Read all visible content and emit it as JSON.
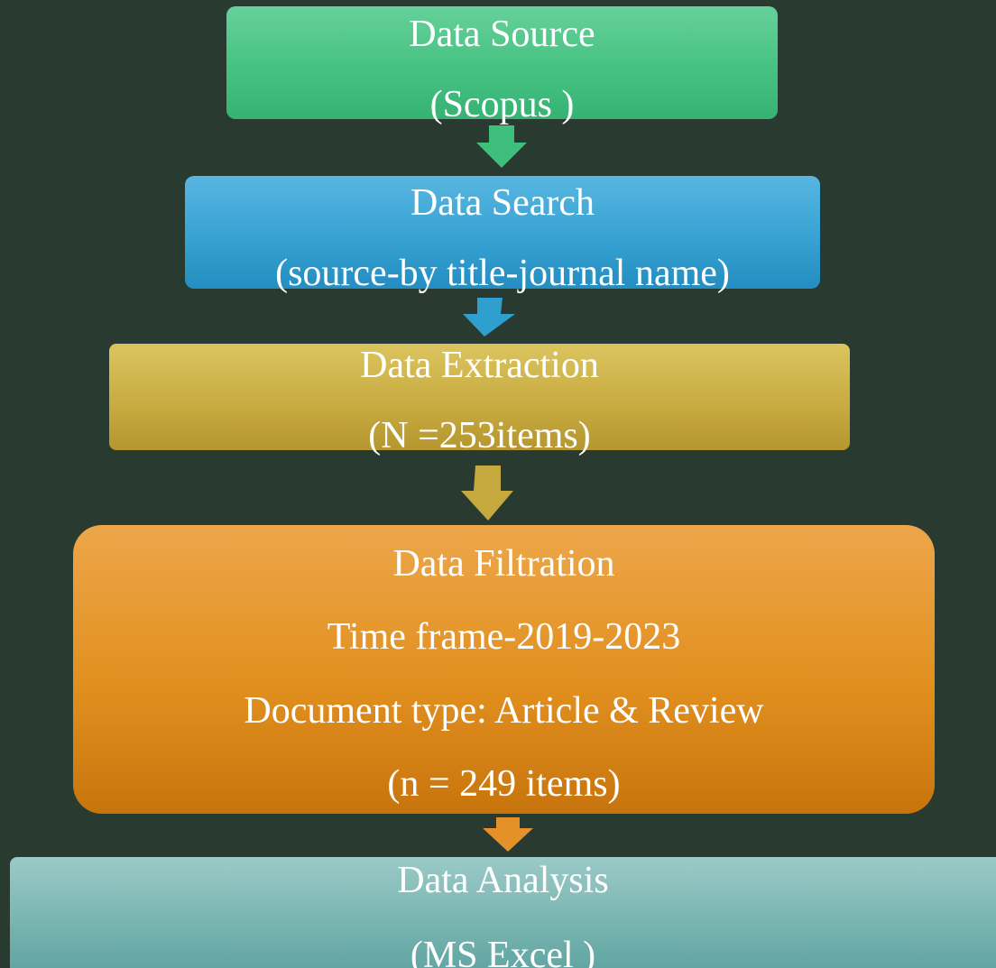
{
  "steps": [
    {
      "title": "Data Source",
      "detail": "(Scopus )"
    },
    {
      "title": "Data Search",
      "detail": "(source-by title-journal name)"
    },
    {
      "title": "Data Extraction",
      "detail": "(N =253items)"
    },
    {
      "title": "Data Filtration",
      "lines": [
        "Time frame-2019-2023",
        "Document type: Article & Review",
        "(n = 249 items)"
      ]
    },
    {
      "title": "Data Analysis",
      "detail": "(MS Excel )"
    }
  ],
  "colors": {
    "background": "#293a31",
    "source": "#46c281",
    "search": "#37a2d3",
    "extraction": "#c9ac42",
    "filtration": "#e1901f",
    "analysis": "#7bb6b2",
    "text": "#ffffff"
  },
  "connectors": [
    "arrow-down-icon",
    "arrow-down-icon",
    "arrow-down-icon",
    "arrow-down-icon"
  ]
}
